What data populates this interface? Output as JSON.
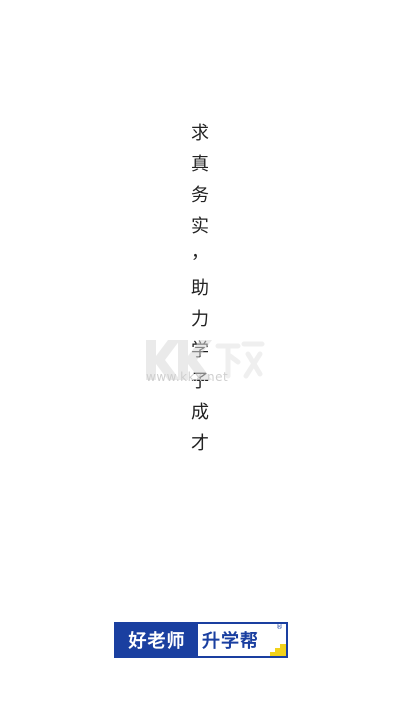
{
  "slogan": {
    "chars": [
      "求",
      "真",
      "务",
      "实",
      "，",
      "助",
      "力",
      "学",
      "子",
      "成",
      "才"
    ]
  },
  "watermark": {
    "mark_text": "KK下载",
    "url": "www.kkx.net"
  },
  "logo": {
    "part1": "好老师",
    "part2": "升学帮",
    "registered": "®"
  },
  "colors": {
    "background": "#ffffff",
    "text": "#222222",
    "brand_blue": "#1a3fa0",
    "brand_yellow": "#f2d21b"
  }
}
